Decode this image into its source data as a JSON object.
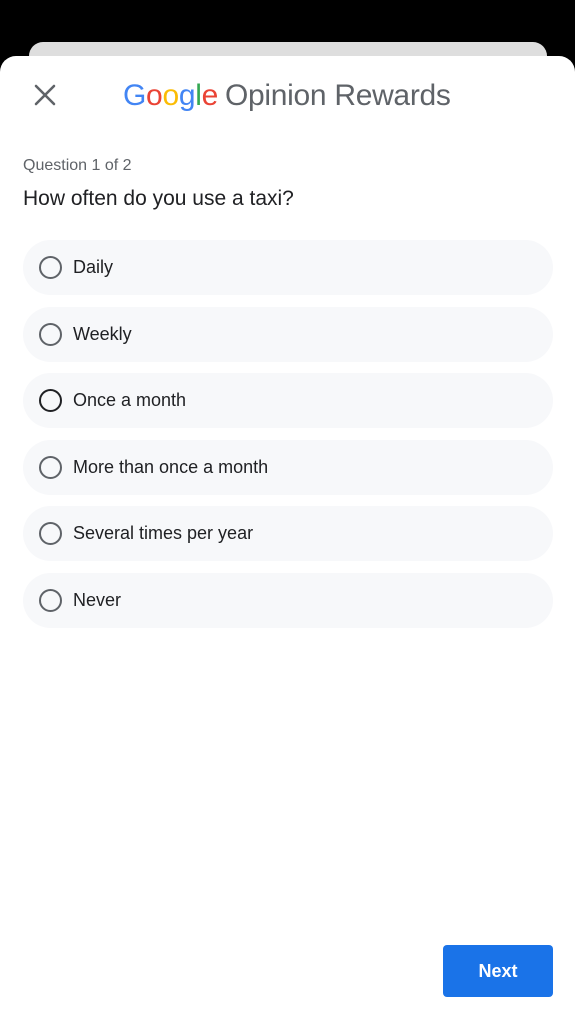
{
  "header": {
    "close_icon": "close-icon",
    "brand": {
      "google_letters": [
        "G",
        "o",
        "o",
        "g",
        "l",
        "e"
      ],
      "rest": "Opinion Rewards"
    }
  },
  "survey": {
    "progress_text": "Question 1 of 2",
    "question": "How often do you use a taxi?",
    "options": [
      {
        "label": "Daily",
        "selected": false
      },
      {
        "label": "Weekly",
        "selected": false
      },
      {
        "label": "Once a month",
        "selected": false
      },
      {
        "label": "More than once a month",
        "selected": false
      },
      {
        "label": "Several times per year",
        "selected": false
      },
      {
        "label": "Never",
        "selected": false
      }
    ]
  },
  "footer": {
    "next_label": "Next"
  },
  "colors": {
    "accent": "#1a73e8",
    "option_bg": "#f7f8fa"
  }
}
